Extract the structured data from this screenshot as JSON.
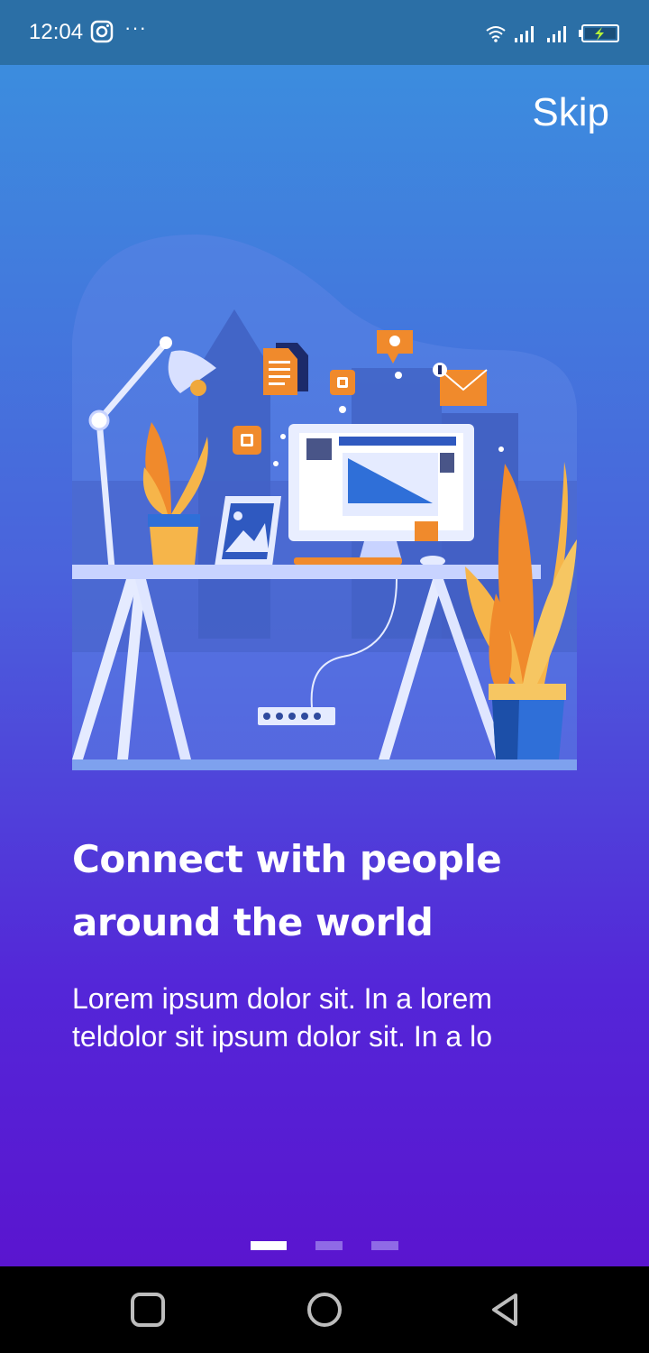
{
  "status_bar": {
    "time": "12:04",
    "more": "···",
    "icons": [
      "instagram-icon",
      "wifi-icon",
      "signal-icon",
      "signal-icon",
      "battery-charging-icon"
    ]
  },
  "header": {
    "skip_label": "Skip"
  },
  "onboarding": {
    "headline_line1": "Connect with people",
    "headline_line2": "around the world",
    "body_line1": "Lorem ipsum dolor sit. In a lorem",
    "body_line2": "teldolor sit ipsum dolor sit. In a lo",
    "page_index": 1,
    "page_count": 3
  },
  "nav_bar": {
    "icons": [
      "recent-apps-icon",
      "home-icon",
      "back-icon"
    ]
  },
  "colors": {
    "gradient_top": "#3a92de",
    "gradient_bottom": "#5a15cf",
    "accent_orange": "#f08a2c",
    "dot_active": "#ffffff",
    "dot_inactive": "#8f6ae6"
  }
}
